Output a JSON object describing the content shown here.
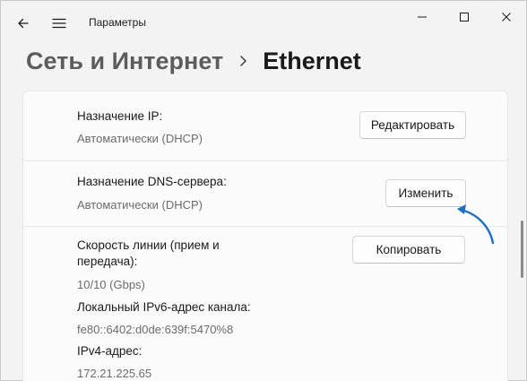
{
  "titlebar": {
    "title": "Параметры",
    "back_icon": "arrow-left-icon",
    "menu_icon": "hamburger-icon",
    "minimize_icon": "minimize-icon",
    "maximize_icon": "maximize-icon",
    "close_icon": "close-icon"
  },
  "breadcrumb": {
    "parent": "Сеть и Интернет",
    "separator_icon": "chevron-right-icon",
    "current": "Ethernet"
  },
  "settings": {
    "ip_assignment": {
      "label": "Назначение IP:",
      "value": "Автоматически (DHCP)",
      "button": "Редактировать"
    },
    "dns_assignment": {
      "label": "Назначение DNS-сервера:",
      "value": "Автоматически (DHCP)",
      "button": "Изменить"
    },
    "properties": {
      "speed_label_line1": "Скорость линии (прием и",
      "speed_label_line2": "передача):",
      "speed_value": "10/10 (Gbps)",
      "ipv6_label": "Локальный IPv6-адрес канала:",
      "ipv6_value": "fe80::6402:d0de:639f:5470%8",
      "ipv4_label": "IPv4-адрес:",
      "ipv4_value": "172.21.225.65",
      "button": "Копировать"
    }
  },
  "colors": {
    "window_bg": "#f3f3f3",
    "card_bg": "#fbfbfb",
    "annotation_arrow": "#1f6fc5"
  }
}
